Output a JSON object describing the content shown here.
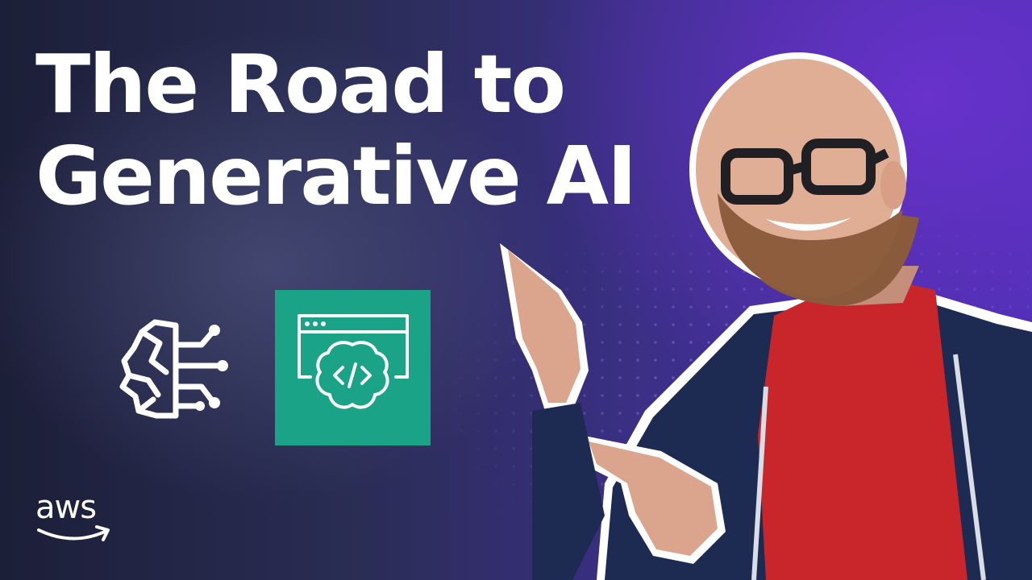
{
  "thumbnail": {
    "title_line1": "The Road to",
    "title_line2": "Generative AI",
    "logo_text": "aws"
  },
  "icons": {
    "brain": "ai-brain-circuit-icon",
    "app_tile": "code-brain-browser-icon"
  },
  "colors": {
    "tile_green": "#1aa386",
    "title_white": "#ffffff",
    "shirt_red": "#c8262b",
    "hoodie_navy": "#1d2b52"
  }
}
